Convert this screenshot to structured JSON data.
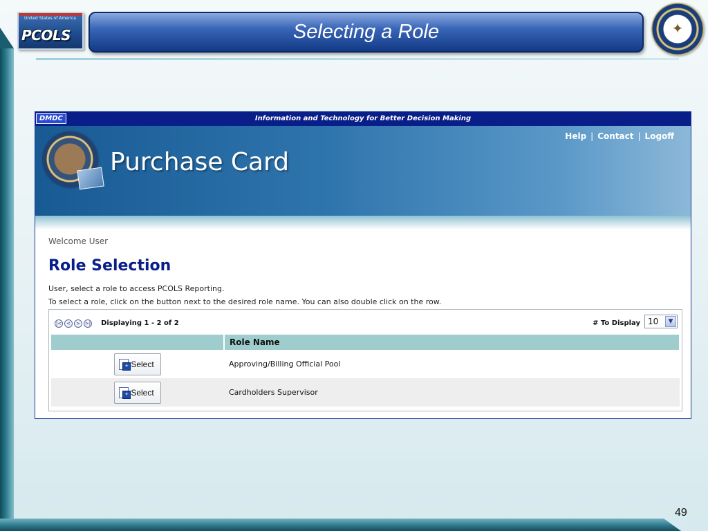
{
  "slide": {
    "title": "Selecting a Role",
    "page_number": "49",
    "pcols_logo_text": "PCOLS",
    "pcols_logo_small": "United States of America"
  },
  "app": {
    "org_badge": "DMDC",
    "tagline": "Information and Technology for Better Decision Making",
    "product_title": "Purchase Card",
    "header_links": {
      "help": "Help",
      "contact": "Contact",
      "logoff": "Logoff",
      "separator": "|"
    },
    "welcome": "Welcome User",
    "heading": "Role Selection",
    "instruction_1": "User, select a role to access PCOLS Reporting.",
    "instruction_2": "To select a role, click on the button next to the desired role name.  You can also double click on the row.",
    "pager": {
      "displaying": "Displaying 1 - 2 of 2",
      "to_display_label": "# To Display",
      "to_display_value": "10",
      "icons": [
        "first-page-icon",
        "previous-page-icon",
        "next-page-icon",
        "last-page-icon"
      ]
    },
    "table": {
      "columns": [
        "",
        "Role Name"
      ],
      "rows": [
        {
          "button": "Select",
          "role_name": "Approving/Billing Official Pool"
        },
        {
          "button": "Select",
          "role_name": "Cardholders Supervisor"
        }
      ]
    }
  },
  "colors": {
    "title_bar": "#1e4a9e",
    "app_topbar": "#0a1e8a",
    "heading": "#0a1e8a",
    "table_header": "#9fcdcd"
  }
}
